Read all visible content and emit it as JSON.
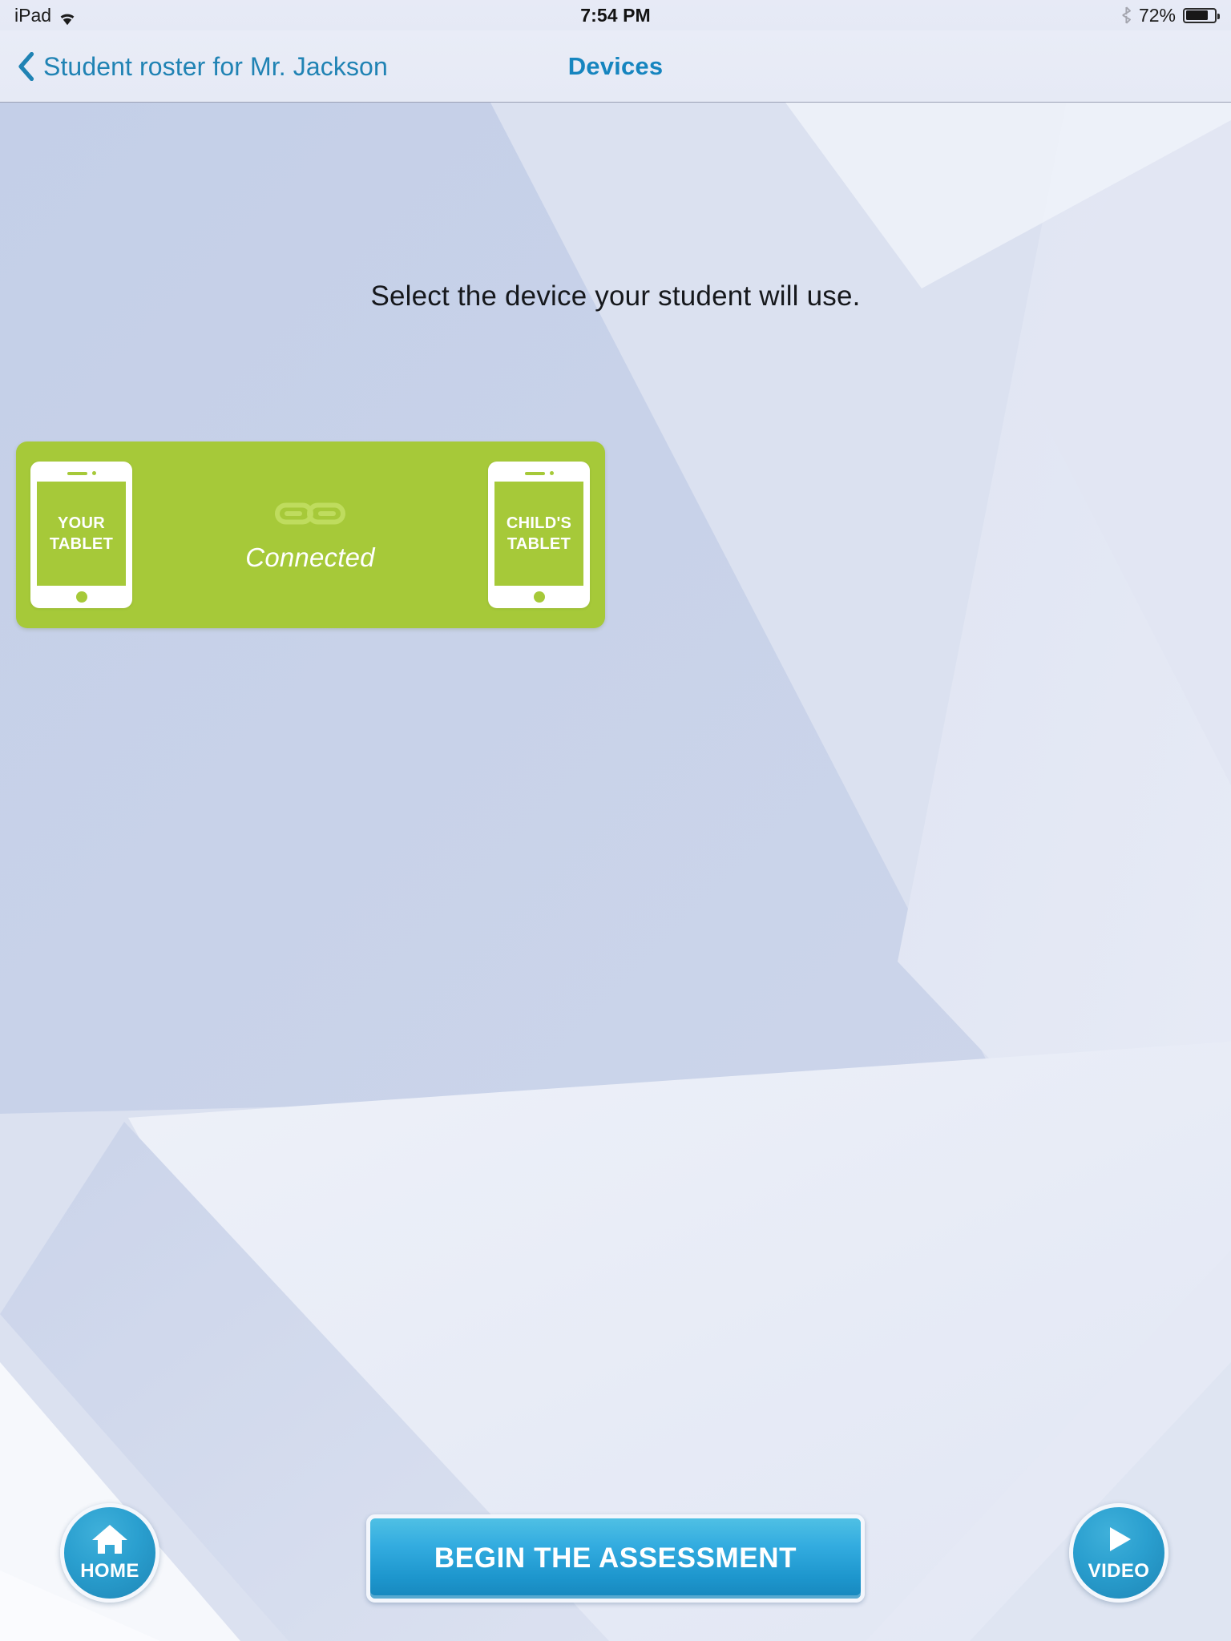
{
  "status_bar": {
    "device_label": "iPad",
    "wifi_icon": "wifi-icon",
    "time": "7:54 PM",
    "bluetooth_icon": "bluetooth-icon",
    "battery_percent": "72%",
    "battery_level": 72
  },
  "nav_bar": {
    "back_icon": "chevron-left-icon",
    "back_label": "Student roster for Mr. Jackson",
    "title": "Devices",
    "accent_color": "#1c84b4"
  },
  "main": {
    "prompt": "Select the device your student will use.",
    "device_card": {
      "status_label": "Connected",
      "link_icon": "chain-link-icon",
      "background_color": "#a6c939",
      "left_tablet": {
        "line1": "YOUR",
        "line2": "TABLET"
      },
      "right_tablet": {
        "line1": "CHILD'S",
        "line2": "TABLET"
      }
    }
  },
  "bottom_bar": {
    "home_button": {
      "icon": "home-icon",
      "label": "HOME"
    },
    "primary_button": {
      "label": "BEGIN THE ASSESSMENT",
      "color": "#1d96cd"
    },
    "video_button": {
      "icon": "play-icon",
      "label": "VIDEO"
    }
  }
}
